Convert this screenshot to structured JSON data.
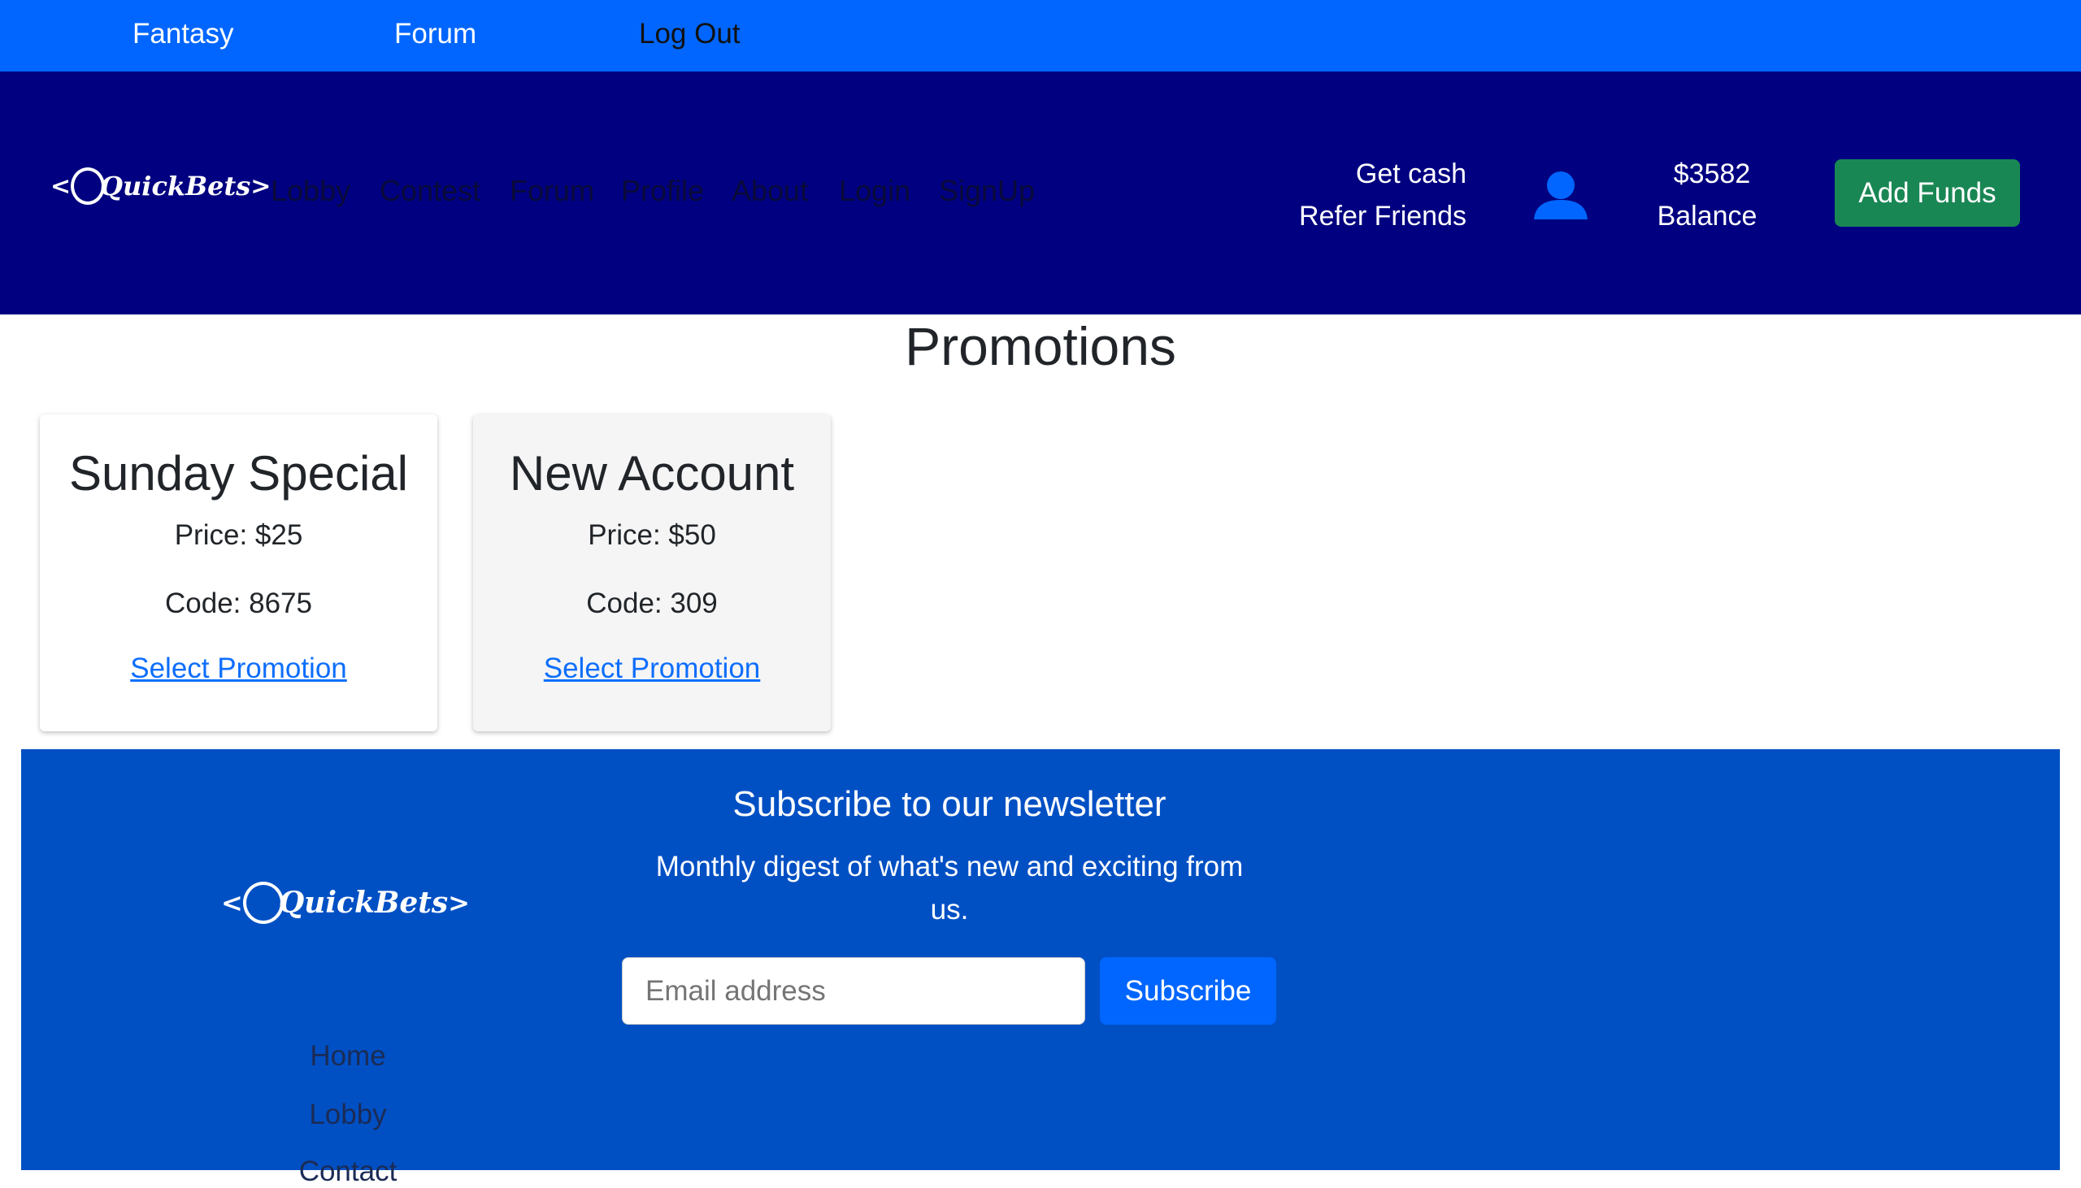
{
  "topbar": {
    "items": [
      "Fantasy",
      "Forum",
      "Log Out"
    ]
  },
  "nav": {
    "logo": "QuickBets",
    "links": [
      "Lobby",
      "Contest",
      "Forum",
      "Profile",
      "About",
      "Login",
      "SignUp"
    ],
    "refer_line1": "Get cash",
    "refer_line2": "Refer Friends",
    "balance_amount": "$3582",
    "balance_label": "Balance",
    "add_funds": "Add Funds"
  },
  "page": {
    "title": "Promotions"
  },
  "promotions": [
    {
      "title": "Sunday Special",
      "price": "Price: $25",
      "code": "Code: 8675",
      "link": "Select Promotion"
    },
    {
      "title": "New Account",
      "price": "Price: $50",
      "code": "Code: 309",
      "link": "Select Promotion"
    }
  ],
  "footer": {
    "logo": "QuickBets",
    "heading": "Subscribe to our newsletter",
    "description": "Monthly digest of what's new and exciting from us.",
    "email_placeholder": "Email address",
    "subscribe": "Subscribe",
    "links": [
      "Home",
      "Lobby",
      "Contact"
    ]
  },
  "colors": {
    "topbar": "#0066ff",
    "nav": "#000080",
    "add_funds": "#198754",
    "footer": "#0050c4"
  }
}
